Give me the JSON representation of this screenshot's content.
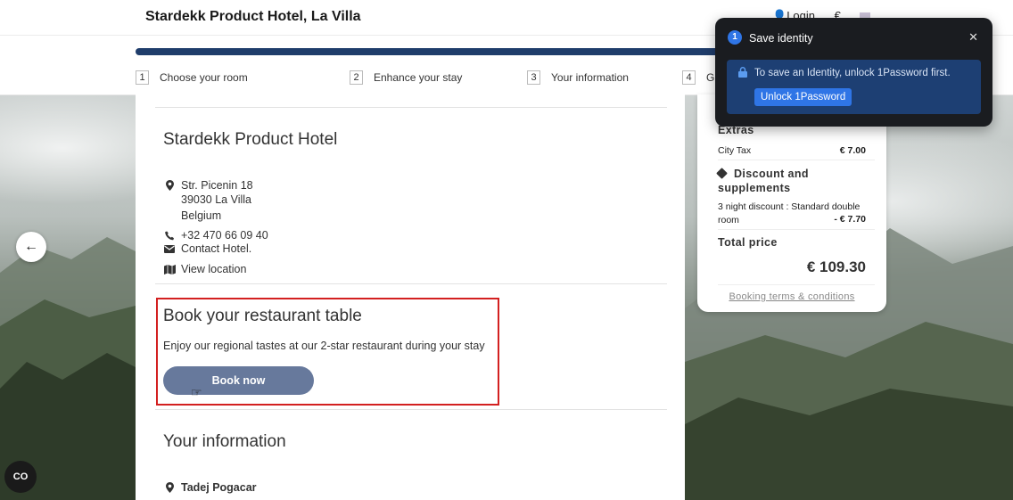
{
  "header": {
    "title": "Stardekk Product Hotel, La Villa",
    "login_label": "Login",
    "currency_symbol": "€"
  },
  "steps": [
    {
      "num": "1",
      "label": "Choose your room"
    },
    {
      "num": "2",
      "label": "Enhance your stay"
    },
    {
      "num": "3",
      "label": "Your information"
    },
    {
      "num": "4",
      "label": "Gu"
    }
  ],
  "hotel": {
    "name": "Stardekk Product Hotel",
    "street": "Str. Picenin 18",
    "city": "39030  La Villa",
    "country": "Belgium",
    "phone": "+32 470 66 09 40",
    "contact_label": "Contact Hotel.",
    "location_label": "View location"
  },
  "restaurant": {
    "title": "Book your restaurant table",
    "description": "Enjoy our regional tastes at our 2-star restaurant during your stay",
    "button_label": "Book now"
  },
  "your_info": {
    "title": "Your information",
    "guest_name": "Tadej Pogacar"
  },
  "summary": {
    "extras_heading": "Extras",
    "city_tax_label": "City Tax",
    "city_tax_value": "€ 7.00",
    "discount_heading": "Discount and supplements",
    "discount_label": "3 night discount : Standard double room",
    "discount_value": "- € 7.70",
    "total_heading": "Total price",
    "total_value": "€ 109.30",
    "terms_label": "Booking terms & conditions"
  },
  "onepassword": {
    "title": "Save identity",
    "message": "To save an Identity, unlock 1Password first.",
    "button_label": "Unlock 1Password"
  },
  "colors": {
    "progress": "#1f3d6b",
    "book_button": "#67799c",
    "highlight_border": "#d32020",
    "op_accent": "#2f75e6"
  }
}
